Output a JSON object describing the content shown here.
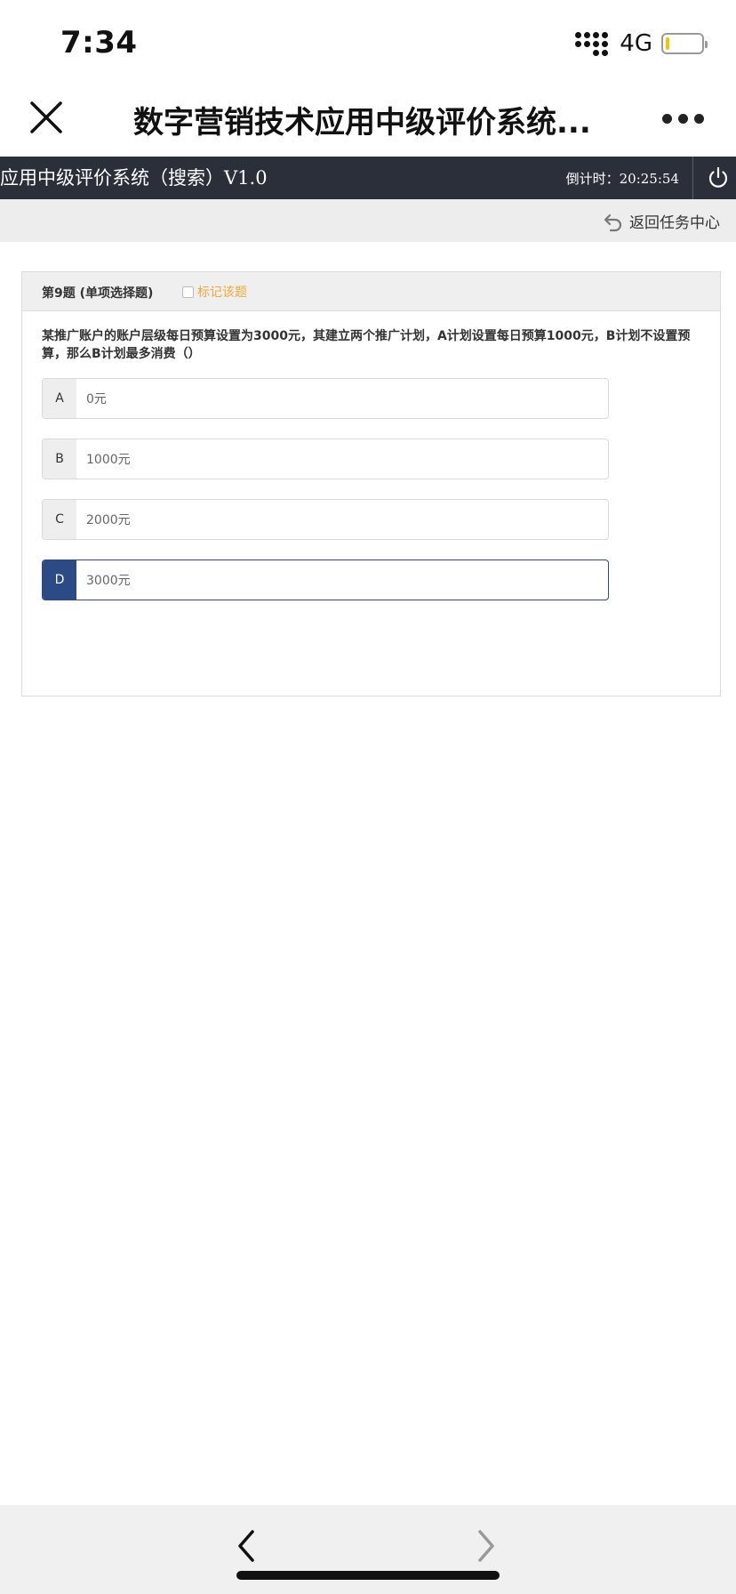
{
  "status_bar": {
    "time": "7:34",
    "network": "4G"
  },
  "nav": {
    "title": "数字营销技术应用中级评价系统..."
  },
  "app_header": {
    "title": "应用中级评价系统（搜索）V1.0",
    "countdown": "倒计时：20:25:54"
  },
  "toolbar": {
    "back_label": "返回任务中心"
  },
  "question": {
    "number": "第9题 (单项选择题)",
    "mark_label": "标记该题",
    "text": "某推广账户的账户层级每日预算设置为3000元，其建立两个推广计划，A计划设置每日预算1000元，B计划不设置预算，那么B计划最多消费（）",
    "options": [
      {
        "letter": "A",
        "text": "0元"
      },
      {
        "letter": "B",
        "text": "1000元"
      },
      {
        "letter": "C",
        "text": "2000元"
      },
      {
        "letter": "D",
        "text": "3000元"
      }
    ],
    "selected": "D"
  },
  "colors": {
    "header_bg": "#2a2f3a",
    "selected_accent": "#2b4a86",
    "mark_label": "#f0a83c"
  }
}
